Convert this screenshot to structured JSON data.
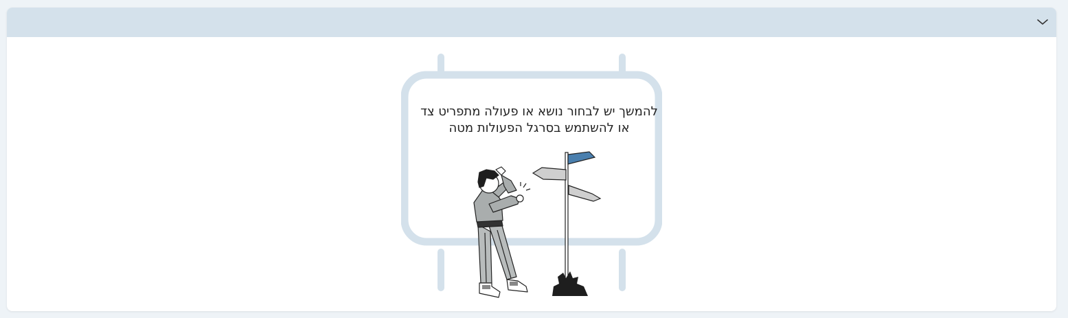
{
  "panel": {
    "header_color": "#d4e1eb",
    "toggle_icon": "chevron-down-icon"
  },
  "empty_state": {
    "line1": "להמשך יש לבחור נושא או פעולה מתפריט צד",
    "line2": "או להשתמש בסרגל הפעולות מטה",
    "illustration": "person-at-signpost",
    "frame_color": "#d4e1eb",
    "accent_color": "#4a7fae"
  }
}
